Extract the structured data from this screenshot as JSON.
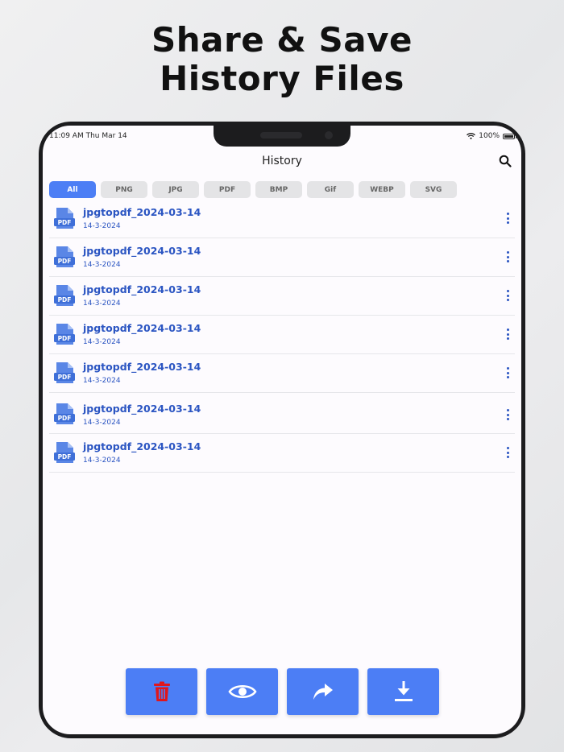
{
  "headline": {
    "line1": "Share & Save",
    "line2": "History Files"
  },
  "status": {
    "time": "11:09 AM   Thu Mar 14",
    "battery": "100%"
  },
  "header": {
    "title": "History"
  },
  "tabs": [
    {
      "label": "All",
      "active": true
    },
    {
      "label": "PNG"
    },
    {
      "label": "JPG"
    },
    {
      "label": "PDF"
    },
    {
      "label": "BMP"
    },
    {
      "label": "Gif"
    },
    {
      "label": "WEBP"
    },
    {
      "label": "SVG"
    }
  ],
  "files": [
    {
      "name": "jpgtopdf_2024-03-14",
      "date": "14-3-2024",
      "icon_text": "PDF"
    },
    {
      "name": "jpgtopdf_2024-03-14",
      "date": "14-3-2024",
      "icon_text": "PDF"
    },
    {
      "name": "jpgtopdf_2024-03-14",
      "date": "14-3-2024",
      "icon_text": "PDF"
    },
    {
      "name": "jpgtopdf_2024-03-14",
      "date": "14-3-2024",
      "icon_text": "PDF"
    },
    {
      "name": "jpgtopdf_2024-03-14",
      "date": "14-3-2024",
      "icon_text": "PDF"
    },
    {
      "name": "jpgtopdf_2024-03-14",
      "date": "14-3-2024",
      "icon_text": "PDF"
    },
    {
      "name": "jpgtopdf_2024-03-14",
      "date": "14-3-2024",
      "icon_text": "PDF"
    }
  ],
  "actions": {
    "delete": "trash-icon",
    "view": "eye-icon",
    "share": "share-arrow-icon",
    "download": "download-icon"
  },
  "colors": {
    "accent": "#4c7ef5",
    "file_text": "#2b55c2",
    "delete_icon": "#e0161c"
  }
}
